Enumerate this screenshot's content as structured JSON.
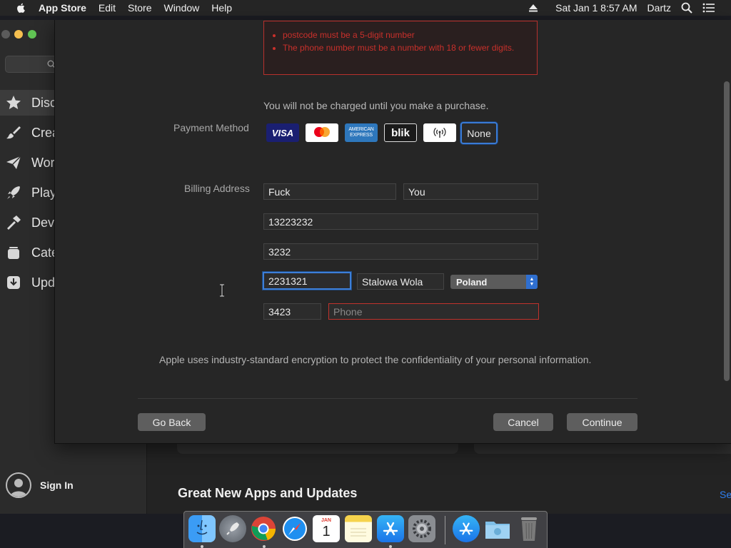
{
  "menubar": {
    "app": "App Store",
    "items": [
      "Edit",
      "Store",
      "Window",
      "Help"
    ],
    "datetime": "Sat Jan 1  8:57 AM",
    "user": "Dartz"
  },
  "sidebar": {
    "items": [
      "Disc",
      "Crea",
      "Wor",
      "Play",
      "Dev",
      "Cate",
      "Upd"
    ],
    "sign_in": "Sign In"
  },
  "content": {
    "section_title": "Great New Apps and Updates",
    "see_all": "Se"
  },
  "sheet": {
    "errors": [
      "postcode must be a 5-digit number",
      "The phone number must be a number with 18 or fewer digits."
    ],
    "charge_note": "You will not be charged until you make a purchase.",
    "payment_label": "Payment Method",
    "payment_options": {
      "visa": "VISA",
      "amex": "AMERICAN EXPRESS",
      "blik": "blik",
      "none": "None"
    },
    "billing_label": "Billing Address",
    "fields": {
      "first_name": "Fuck",
      "last_name": "You",
      "street1": "13223232",
      "street2": "3232",
      "postcode": "2231321",
      "city": "Stalowa Wola",
      "country": "Poland",
      "area_code": "3423",
      "phone_placeholder": "Phone"
    },
    "encryption_note": "Apple uses industry-standard encryption to protect the confidentiality of your personal information.",
    "go_back": "Go Back",
    "cancel": "Cancel",
    "continue": "Continue"
  },
  "dock": {
    "calendar_month": "JAN",
    "calendar_day": "1",
    "icons": [
      "finder-icon",
      "launchpad-icon",
      "chrome-icon",
      "safari-icon",
      "calendar-icon",
      "notes-icon",
      "app-store-icon",
      "system-preferences-icon",
      "app-store-downloads-icon",
      "folder-icon",
      "trash-icon"
    ]
  },
  "colors": {
    "accent": "#3d7fd8",
    "error": "#c0322c"
  }
}
